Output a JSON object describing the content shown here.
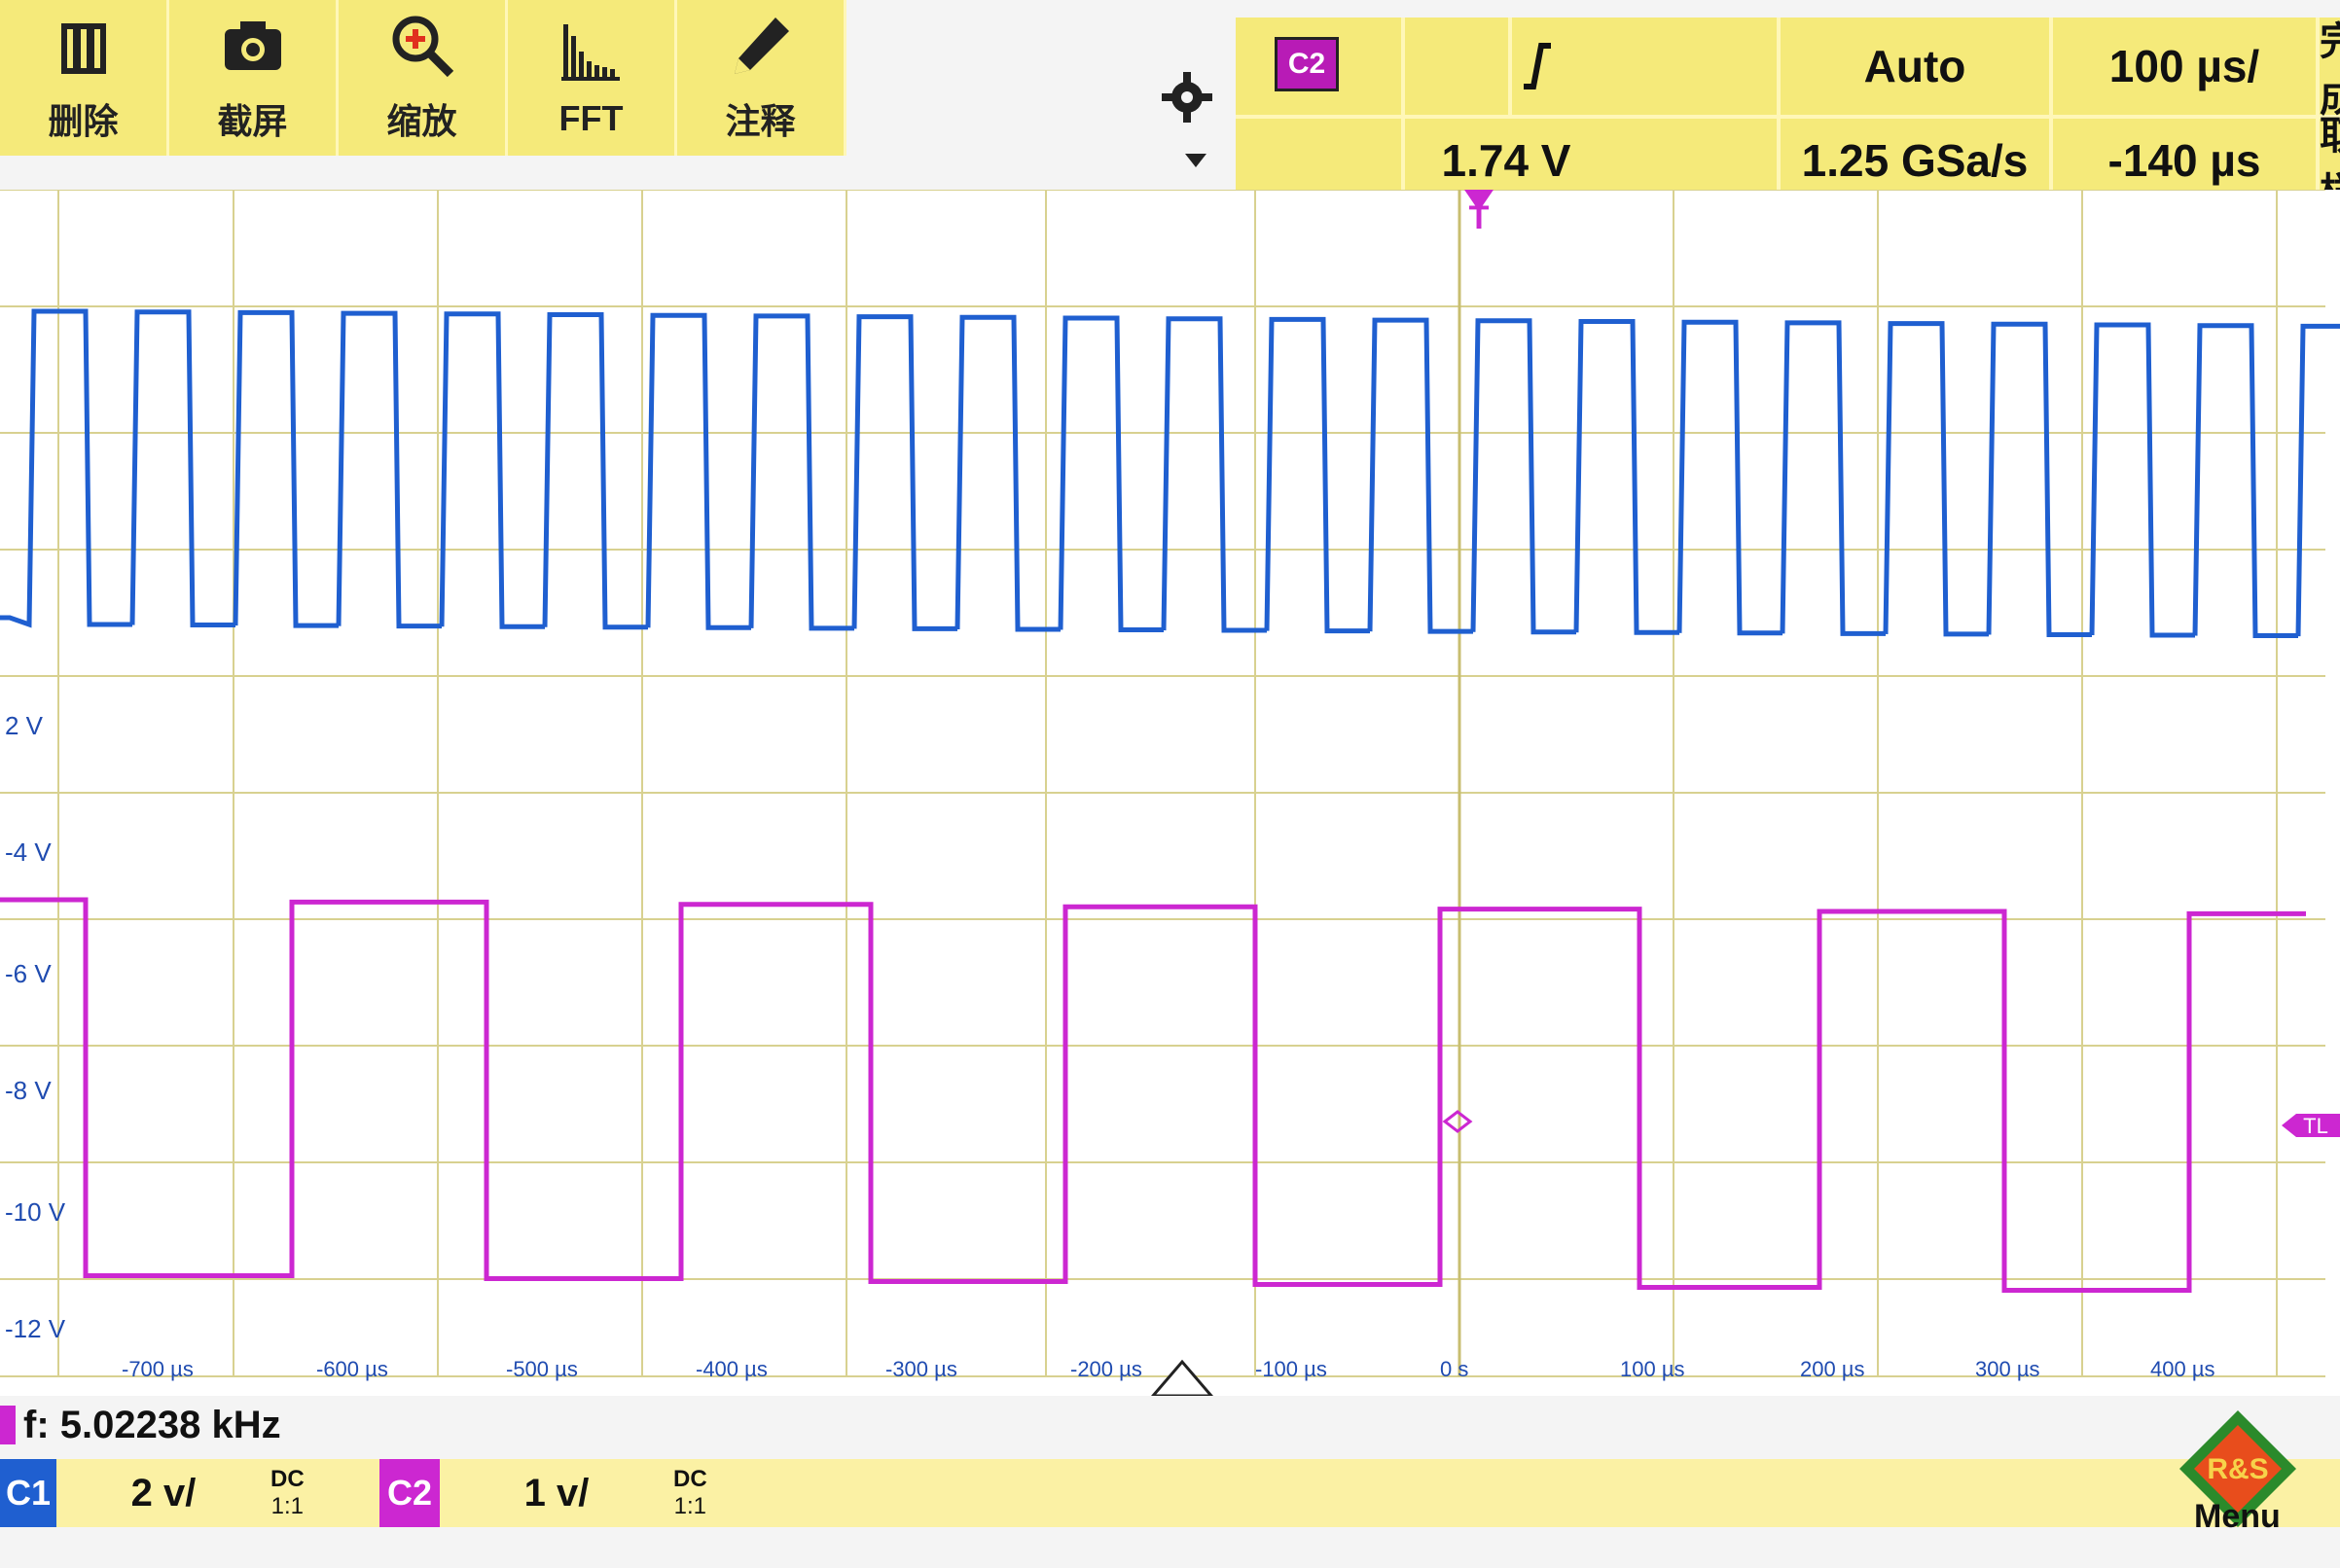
{
  "toolbar": {
    "items": [
      {
        "label": "删除",
        "icon": "trash-icon"
      },
      {
        "label": "截屏",
        "icon": "camera-icon"
      },
      {
        "label": "缩放",
        "icon": "zoom-icon"
      },
      {
        "label": "FFT",
        "icon": "fft-icon"
      },
      {
        "label": "注释",
        "icon": "pencil-icon"
      }
    ]
  },
  "status": {
    "channel": "C2",
    "trigger_level": "1.74 V",
    "trigger_slope_icon": "rising-edge-icon",
    "mode": "Auto",
    "sample_rate": "1.25 GSa/s",
    "time_per_div": "100 µs/",
    "offset": "-140 µs",
    "done": "完成",
    "sample": "取样"
  },
  "screen": {
    "y_labels": [
      "2 V",
      "-4 V",
      "-6 V",
      "-8 V",
      "-10 V",
      "-12 V"
    ],
    "x_labels": [
      "-700 µs",
      "-600 µs",
      "-500 µs",
      "-400 µs",
      "-300 µs",
      "-200 µs",
      "-100 µs",
      "0 s",
      "100 µs",
      "200 µs",
      "300 µs",
      "400 µs"
    ],
    "trigger_marker": "T",
    "trigger_level_marker": "TL"
  },
  "measurement": {
    "label": "f: 5.02238 kHz"
  },
  "channels": [
    {
      "name": "C1",
      "scale": "2 v/",
      "coupling": "DC",
      "ratio": "1:1"
    },
    {
      "name": "C2",
      "scale": "1 v/",
      "coupling": "DC",
      "ratio": "1:1"
    }
  ],
  "menu": {
    "label": "Menu",
    "icon": "rs-logo-icon"
  },
  "colors": {
    "c1": "#1f5fd0",
    "c2": "#cc27d1",
    "accent_yellow": "#f5ea7a",
    "grid": "#d8d190"
  }
}
